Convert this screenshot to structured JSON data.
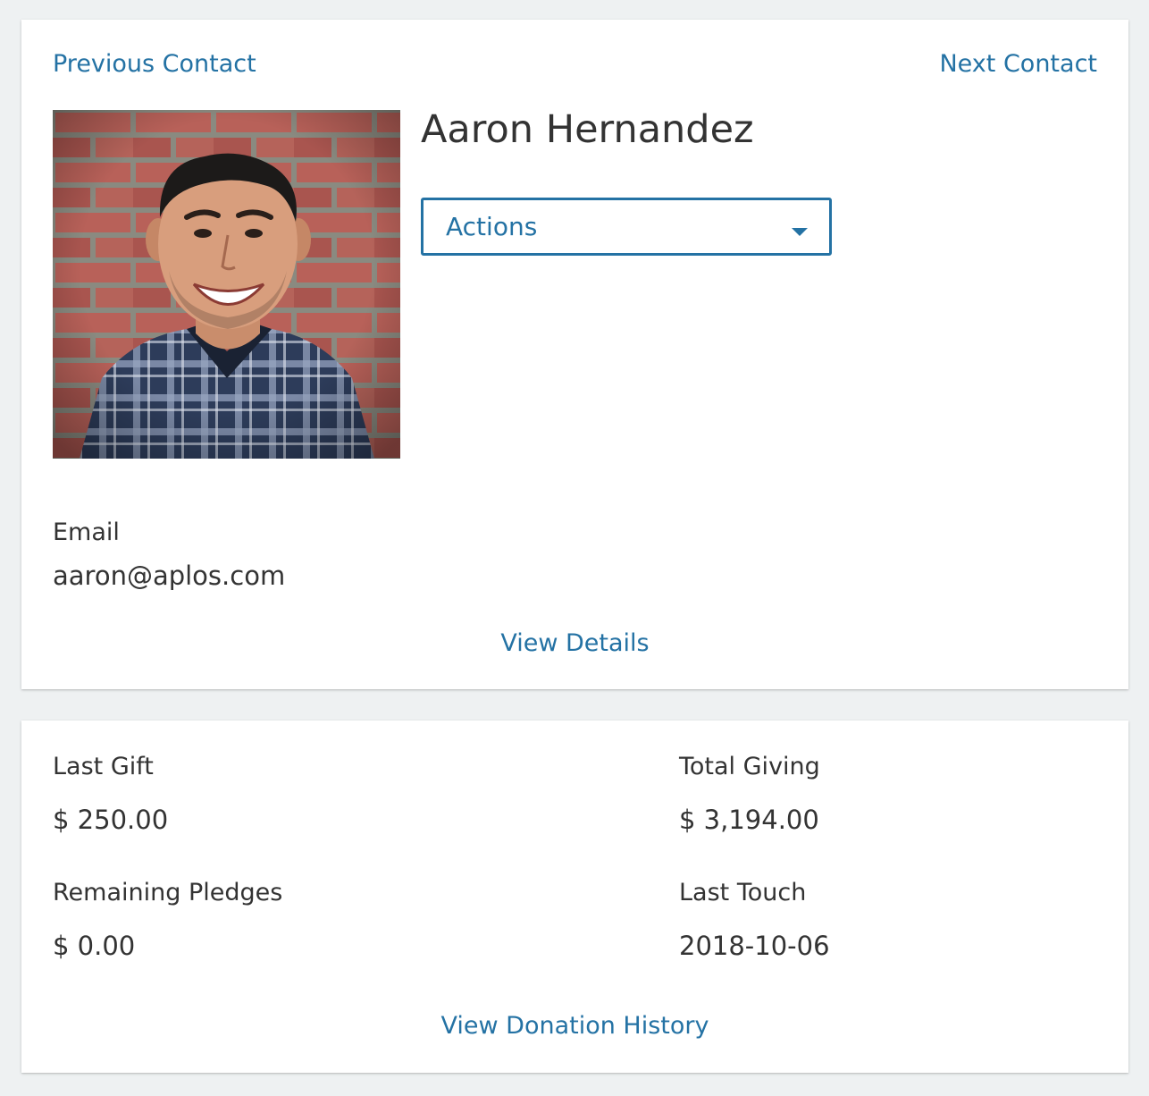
{
  "nav": {
    "previous_label": "Previous Contact",
    "next_label": "Next Contact"
  },
  "contact": {
    "name": "Aaron Hernandez",
    "actions_label": "Actions",
    "email_label": "Email",
    "email_value": "aaron@aplos.com",
    "view_details_label": "View Details"
  },
  "giving": {
    "last_gift_label": "Last Gift",
    "last_gift_value": "$ 250.00",
    "total_giving_label": "Total Giving",
    "total_giving_value": "$ 3,194.00",
    "remaining_pledges_label": "Remaining Pledges",
    "remaining_pledges_value": "$ 0.00",
    "last_touch_label": "Last Touch",
    "last_touch_value": "2018-10-06",
    "view_history_label": "View Donation History"
  },
  "colors": {
    "accent": "#2472a4",
    "text": "#333333",
    "background": "#eef1f2",
    "card": "#ffffff"
  },
  "icons": {
    "actions_dropdown": "caret-down-icon"
  }
}
